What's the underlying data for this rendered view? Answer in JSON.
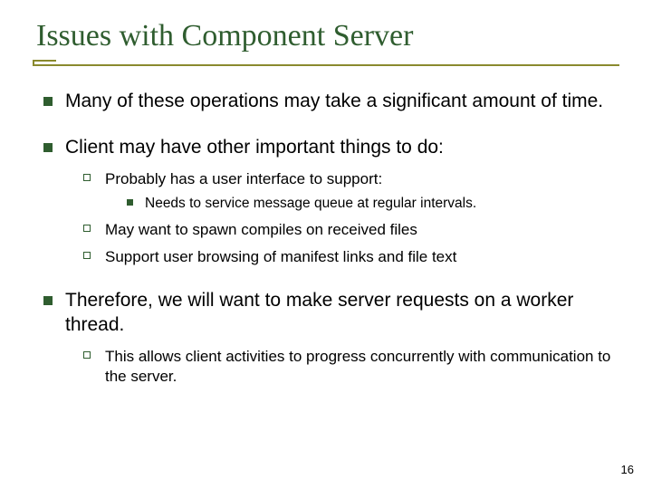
{
  "title": "Issues with Component Server",
  "bullets": [
    {
      "text": "Many of these operations may take a significant amount of time."
    },
    {
      "text": "Client may have other important things to do:",
      "children": [
        {
          "text": "Probably has a user interface to support:",
          "children": [
            {
              "text": "Needs to service message queue at regular intervals."
            }
          ]
        },
        {
          "text": "May want to spawn compiles on received files"
        },
        {
          "text": "Support user browsing of manifest links and file text"
        }
      ]
    },
    {
      "text": "Therefore, we will want to make server requests on a worker thread.",
      "children": [
        {
          "text": "This allows client activities to progress concurrently with communication to the server."
        }
      ]
    }
  ],
  "page_number": "16"
}
